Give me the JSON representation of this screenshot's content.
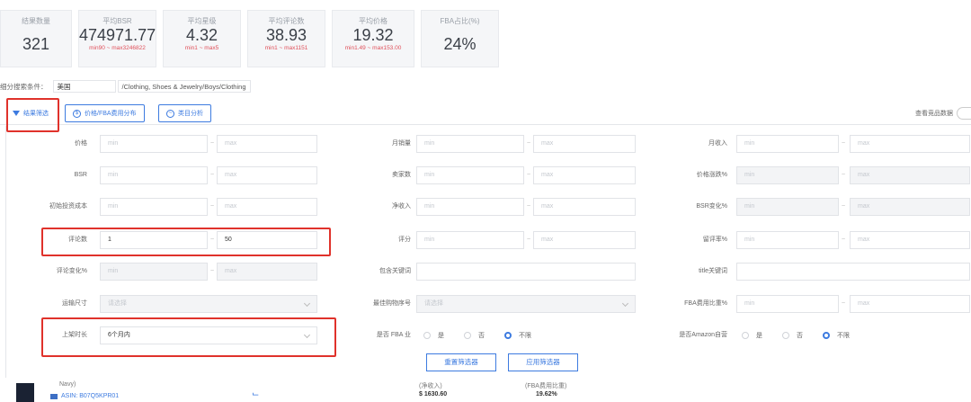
{
  "stats": [
    {
      "label": "结果数量",
      "value": "321",
      "range": ""
    },
    {
      "label": "平均BSR",
      "value": "474971.77",
      "range": "min90 ~ max3246822"
    },
    {
      "label": "平均星级",
      "value": "4.32",
      "range": "min1 ~ max5"
    },
    {
      "label": "平均评论数",
      "value": "38.93",
      "range": "min1 ~ max1151"
    },
    {
      "label": "平均价格",
      "value": "19.32",
      "range": "min1.49 ~ max153.00"
    },
    {
      "label": "FBA占比(%)",
      "value": "24%",
      "range": ""
    }
  ],
  "category": {
    "label": "细分搜索条件：",
    "site": "美国",
    "path": "/Clothing, Shoes & Jewelry/Boys/Clothing"
  },
  "toolbar": {
    "filter": "结果筛选",
    "fba": "价格/FBA费用分布",
    "category": "类目分析",
    "toggle": "查看竞品数据"
  },
  "filters": {
    "price": "价格",
    "monthly_sales": "月销量",
    "monthly_revenue": "月收入",
    "bsr": "BSR",
    "sellers": "卖家数",
    "price_change": "价格涨跌%",
    "initial_cost": "初始投资成本",
    "net_income": "净收入",
    "bsr_change": "BSR变化%",
    "reviews": "评论数",
    "rating": "评分",
    "bad_review": "留评率%",
    "review_change": "评论变化%",
    "include_kw": "包含关键词",
    "exclude_kw": "title关键词",
    "size": "运输尺寸",
    "weight": "最佳购物序号",
    "fba_ratio": "FBA费用比重%",
    "listing_age": "上架时长",
    "is_fba": "是否 FBA 业",
    "is_amazon": "是否Amazon自营"
  },
  "placeholders": {
    "min": "min",
    "max": "max",
    "select": "请选择"
  },
  "values": {
    "reviews_min": "1",
    "reviews_max": "50",
    "listing_age": "6个月内"
  },
  "radio": {
    "yes": "是",
    "no": "否",
    "any": "不限"
  },
  "buttons": {
    "reset": "重置筛选器",
    "apply": "应用筛选器"
  },
  "product_row": {
    "brand": "Navy)",
    "asin": "ASIN: B07Q5KPR01",
    "label1": "(净收入)",
    "value1": "$ 1630.60",
    "label2": "(FBA费用比重)",
    "value2": "19.62%"
  }
}
